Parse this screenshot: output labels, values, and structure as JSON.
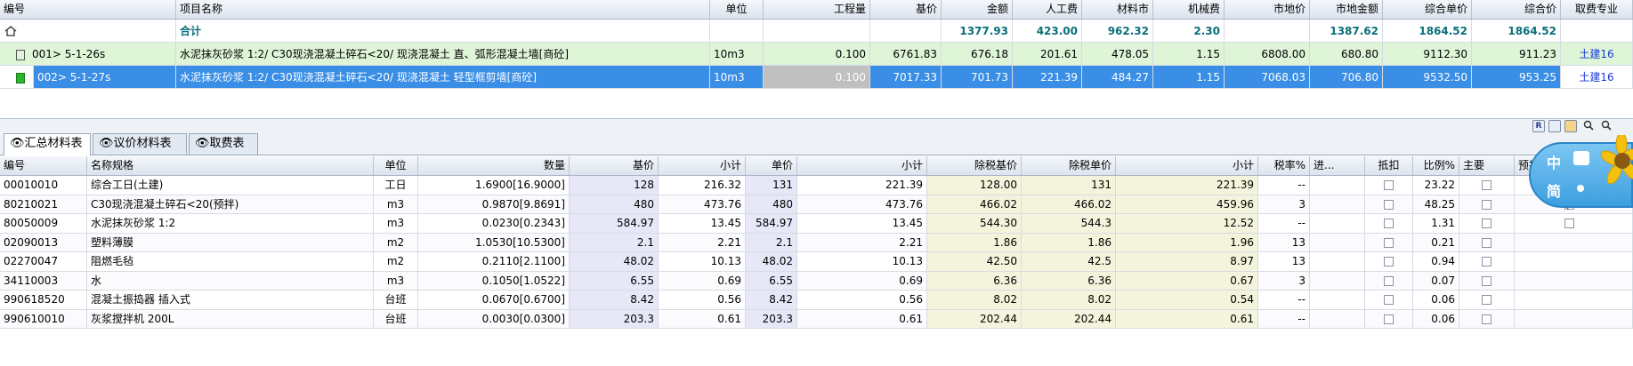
{
  "top_table": {
    "headers": {
      "code": "编号",
      "name": "项目名称",
      "unit": "单位",
      "qty": "工程量",
      "base": "基价",
      "amount": "金额",
      "labor": "人工费",
      "material": "材料市",
      "machine": "机械费",
      "market": "市地价",
      "market_amount": "市地金额",
      "unit_price": "综合单价",
      "total_price": "综合价",
      "specialty": "取费专业"
    },
    "total_row": {
      "name": "合计",
      "amount": "1377.93",
      "labor": "423.00",
      "material": "962.32",
      "machine": "2.30",
      "market_amount": "1387.62",
      "unit_price": "1864.52",
      "total_price": "1864.52"
    },
    "rows": [
      {
        "code": "001> 5-1-26s",
        "name": "水泥抹灰砂浆 1:2/ C30现浇混凝土碎石<20/ 现浇混凝土 直、弧形混凝土墙[商砼]",
        "unit": "10m3",
        "qty": "0.100",
        "base": "6761.83",
        "amount": "676.18",
        "labor": "201.61",
        "material": "478.05",
        "machine": "1.15",
        "market": "6808.00",
        "market_amount": "680.80",
        "unit_price": "9112.30",
        "total_price": "911.23",
        "specialty": "土建16"
      },
      {
        "code": "002> 5-1-27s",
        "name": "水泥抹灰砂浆 1:2/ C30现浇混凝土碎石<20/ 现浇混凝土 轻型框剪墙[商砼]",
        "unit": "10m3",
        "qty": "0.100",
        "base": "7017.33",
        "amount": "701.73",
        "labor": "221.39",
        "material": "484.27",
        "machine": "1.15",
        "market": "7068.03",
        "market_amount": "706.80",
        "unit_price": "9532.50",
        "total_price": "953.25",
        "specialty": "土建16"
      }
    ]
  },
  "tabs": [
    {
      "label": "汇总材料表"
    },
    {
      "label": "议价材料表"
    },
    {
      "label": "取费表"
    }
  ],
  "toolbar_icons": [
    "R",
    "icon",
    "icon",
    "icon",
    "icon"
  ],
  "bottom_table": {
    "headers": {
      "code": "编号",
      "name": "名称规格",
      "unit": "单位",
      "qty": "数量",
      "base": "基价",
      "subtotal": "小计",
      "unit_price": "单价",
      "subtotal2": "小计",
      "ex_tax_base": "除税基价",
      "ex_tax_unit": "除税单价",
      "subtotal3": "小计",
      "tax": "税率%",
      "input": "进...",
      "deduct": "抵扣",
      "ratio": "比例%",
      "main": "主要",
      "pre": "预拌"
    },
    "rows": [
      {
        "code": "00010010",
        "name": "综合工日(土建)",
        "unit": "工日",
        "qty": "1.6900[16.9000]",
        "base": "128",
        "subtotal": "216.32",
        "unit_price": "131",
        "subtotal2": "221.39",
        "ex_tax_base": "128.00",
        "ex_tax_unit": "131",
        "subtotal3": "221.39",
        "tax": "--",
        "ratio": "23.22",
        "pre": false
      },
      {
        "code": "80210021",
        "name": "C30现浇混凝土碎石<20(预拌)",
        "unit": "m3",
        "qty": "0.9870[9.8691]",
        "base": "480",
        "subtotal": "473.76",
        "unit_price": "480",
        "subtotal2": "473.76",
        "ex_tax_base": "466.02",
        "ex_tax_unit": "466.02",
        "subtotal3": "459.96",
        "tax": "3",
        "ratio": "48.25",
        "pre": true
      },
      {
        "code": "80050009",
        "name": "水泥抹灰砂浆 1:2",
        "unit": "m3",
        "qty": "0.0230[0.2343]",
        "base": "584.97",
        "subtotal": "13.45",
        "unit_price": "584.97",
        "subtotal2": "13.45",
        "ex_tax_base": "544.30",
        "ex_tax_unit": "544.3",
        "subtotal3": "12.52",
        "tax": "--",
        "ratio": "1.31",
        "pre": false
      },
      {
        "code": "02090013",
        "name": "塑料薄膜",
        "unit": "m2",
        "qty": "1.0530[10.5300]",
        "base": "2.1",
        "subtotal": "2.21",
        "unit_price": "2.1",
        "subtotal2": "2.21",
        "ex_tax_base": "1.86",
        "ex_tax_unit": "1.86",
        "subtotal3": "1.96",
        "tax": "13",
        "ratio": "0.21",
        "pre": null
      },
      {
        "code": "02270047",
        "name": "阻燃毛毡",
        "unit": "m2",
        "qty": "0.2110[2.1100]",
        "base": "48.02",
        "subtotal": "10.13",
        "unit_price": "48.02",
        "subtotal2": "10.13",
        "ex_tax_base": "42.50",
        "ex_tax_unit": "42.5",
        "subtotal3": "8.97",
        "tax": "13",
        "ratio": "0.94",
        "pre": null
      },
      {
        "code": "34110003",
        "name": "水",
        "unit": "m3",
        "qty": "0.1050[1.0522]",
        "base": "6.55",
        "subtotal": "0.69",
        "unit_price": "6.55",
        "subtotal2": "0.69",
        "ex_tax_base": "6.36",
        "ex_tax_unit": "6.36",
        "subtotal3": "0.67",
        "tax": "3",
        "ratio": "0.07",
        "pre": null
      },
      {
        "code": "990618520",
        "name": "混凝土振捣器 插入式",
        "unit": "台班",
        "qty": "0.0670[0.6700]",
        "base": "8.42",
        "subtotal": "0.56",
        "unit_price": "8.42",
        "subtotal2": "0.56",
        "ex_tax_base": "8.02",
        "ex_tax_unit": "8.02",
        "subtotal3": "0.54",
        "tax": "--",
        "ratio": "0.06",
        "pre": null
      },
      {
        "code": "990610010",
        "name": "灰浆搅拌机 200L",
        "unit": "台班",
        "qty": "0.0030[0.0300]",
        "base": "203.3",
        "subtotal": "0.61",
        "unit_price": "203.3",
        "subtotal2": "0.61",
        "ex_tax_base": "202.44",
        "ex_tax_unit": "202.44",
        "subtotal3": "0.61",
        "tax": "--",
        "ratio": "0.06",
        "pre": null
      }
    ]
  },
  "widget": {
    "line1": "中",
    "line2": "简"
  },
  "colors": {
    "selected": "#3a8ee6",
    "green_row": "#dff5d8",
    "teal_text": "#0a6f7a",
    "lavender": "#e6e8f7",
    "yellow": "#f4f4dc"
  }
}
